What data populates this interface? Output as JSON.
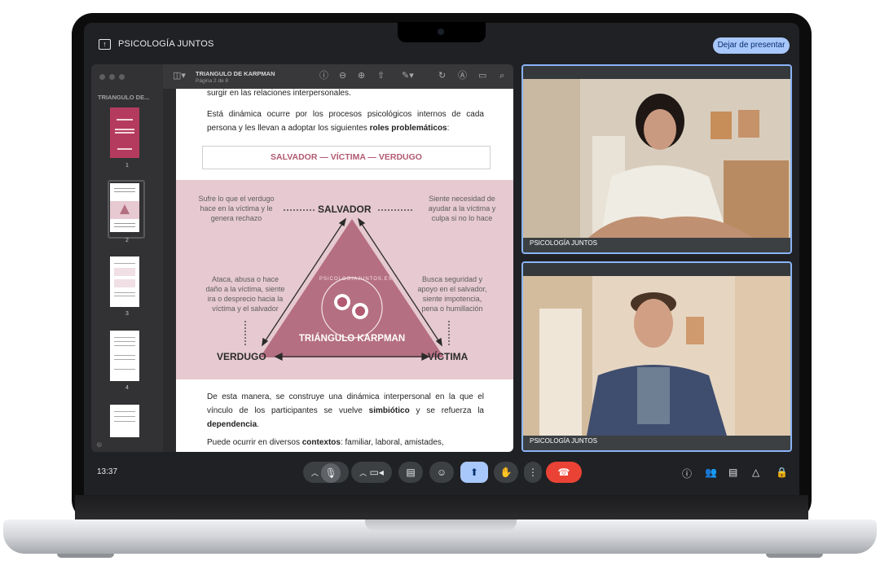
{
  "meet": {
    "title": "PSICOLOGÍA JUNTOS",
    "stop_presenting": "Dejar de presentar",
    "clock": "13:37",
    "participants": [
      {
        "name": "PSICOLOGÍA JUNTOS"
      },
      {
        "name": "PSICOLOGÍA JUNTOS"
      }
    ]
  },
  "viewer": {
    "sidebar_title": "TRIANGULO DE...",
    "doc_title": "TRIANGULO DE KARPMAN",
    "doc_subtitle": "Página 2 de 8",
    "thumbnails": [
      "1",
      "2",
      "3",
      "4"
    ]
  },
  "document": {
    "intro_line": "surgir en las relaciones interpersonales.",
    "para1_a": "Está dinámica ocurre por los procesos psicológicos internos de cada persona y les llevan a adoptar los siguientes ",
    "para1_bold": "roles problemáticos",
    "para1_b": ":",
    "roles_box": "SALVADOR — VÍCTIMA — VERDUGO",
    "diagram": {
      "salvador": "SALVADOR",
      "verdugo": "VERDUGO",
      "victima": "VÍCTIMA",
      "center_title": "TRIÁNGULO KARPMAN",
      "arc_text": "PSICOLOGIAJUNTOS.ES",
      "top_left": [
        "Sufre lo que el verdugo",
        "hace en la víctima y le",
        "genera rechazo"
      ],
      "top_right": [
        "Siente necesidad de",
        "ayudar a la víctima y",
        "culpa si no lo hace"
      ],
      "mid_left": [
        "Ataca, abusa o hace",
        "daño a la víctima, siente",
        "ira o desprecio hacia la",
        "víctima y el salvador"
      ],
      "mid_right": [
        "Busca seguridad y",
        "apoyo en el salvador,",
        "siente impotencia,",
        "pena o humillación"
      ]
    },
    "para2_a": "De esta manera, se construye una dinámica interpersonal en la que el vínculo de los participantes se vuelve ",
    "para2_bold1": "simbiótico",
    "para2_b": " y se refuerza la ",
    "para2_bold2": "dependencia",
    "para2_c": ".",
    "para3_a": "Puede ocurrir en diversos ",
    "para3_bold": "contextos",
    "para3_b": ": familiar, laboral, amistades,"
  },
  "colors": {
    "accent": "#a8c7fa",
    "tile_border": "#8ab4f8",
    "end_call": "#ea4335",
    "triangle": "#b56f82",
    "pink_band": "#e6c9d1"
  },
  "icons": [
    "present-icon",
    "mic-icon",
    "camera-icon",
    "captions-icon",
    "emoji-icon",
    "present-screen-icon",
    "raise-hand-icon",
    "more-options-icon",
    "end-call-icon",
    "info-icon",
    "people-icon",
    "chat-icon",
    "activities-icon",
    "host-controls-icon"
  ]
}
